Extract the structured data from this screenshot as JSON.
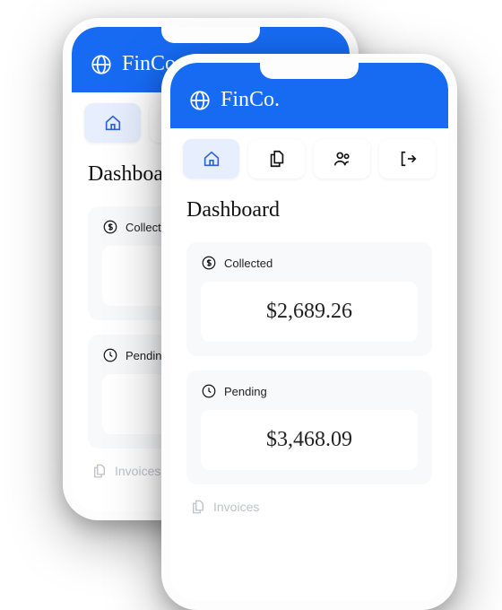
{
  "brand": "FinCo.",
  "page_title": "Dashboard",
  "nav": {
    "items": [
      {
        "name": "home",
        "active": true
      },
      {
        "name": "documents",
        "active": false
      },
      {
        "name": "customers",
        "active": false
      },
      {
        "name": "logout",
        "active": false
      }
    ]
  },
  "cards": {
    "collected": {
      "label": "Collected",
      "value": "$2,689.26"
    },
    "pending": {
      "label": "Pending",
      "value": "$3,468.09"
    }
  },
  "sections": {
    "invoices": {
      "label": "Invoices"
    }
  }
}
